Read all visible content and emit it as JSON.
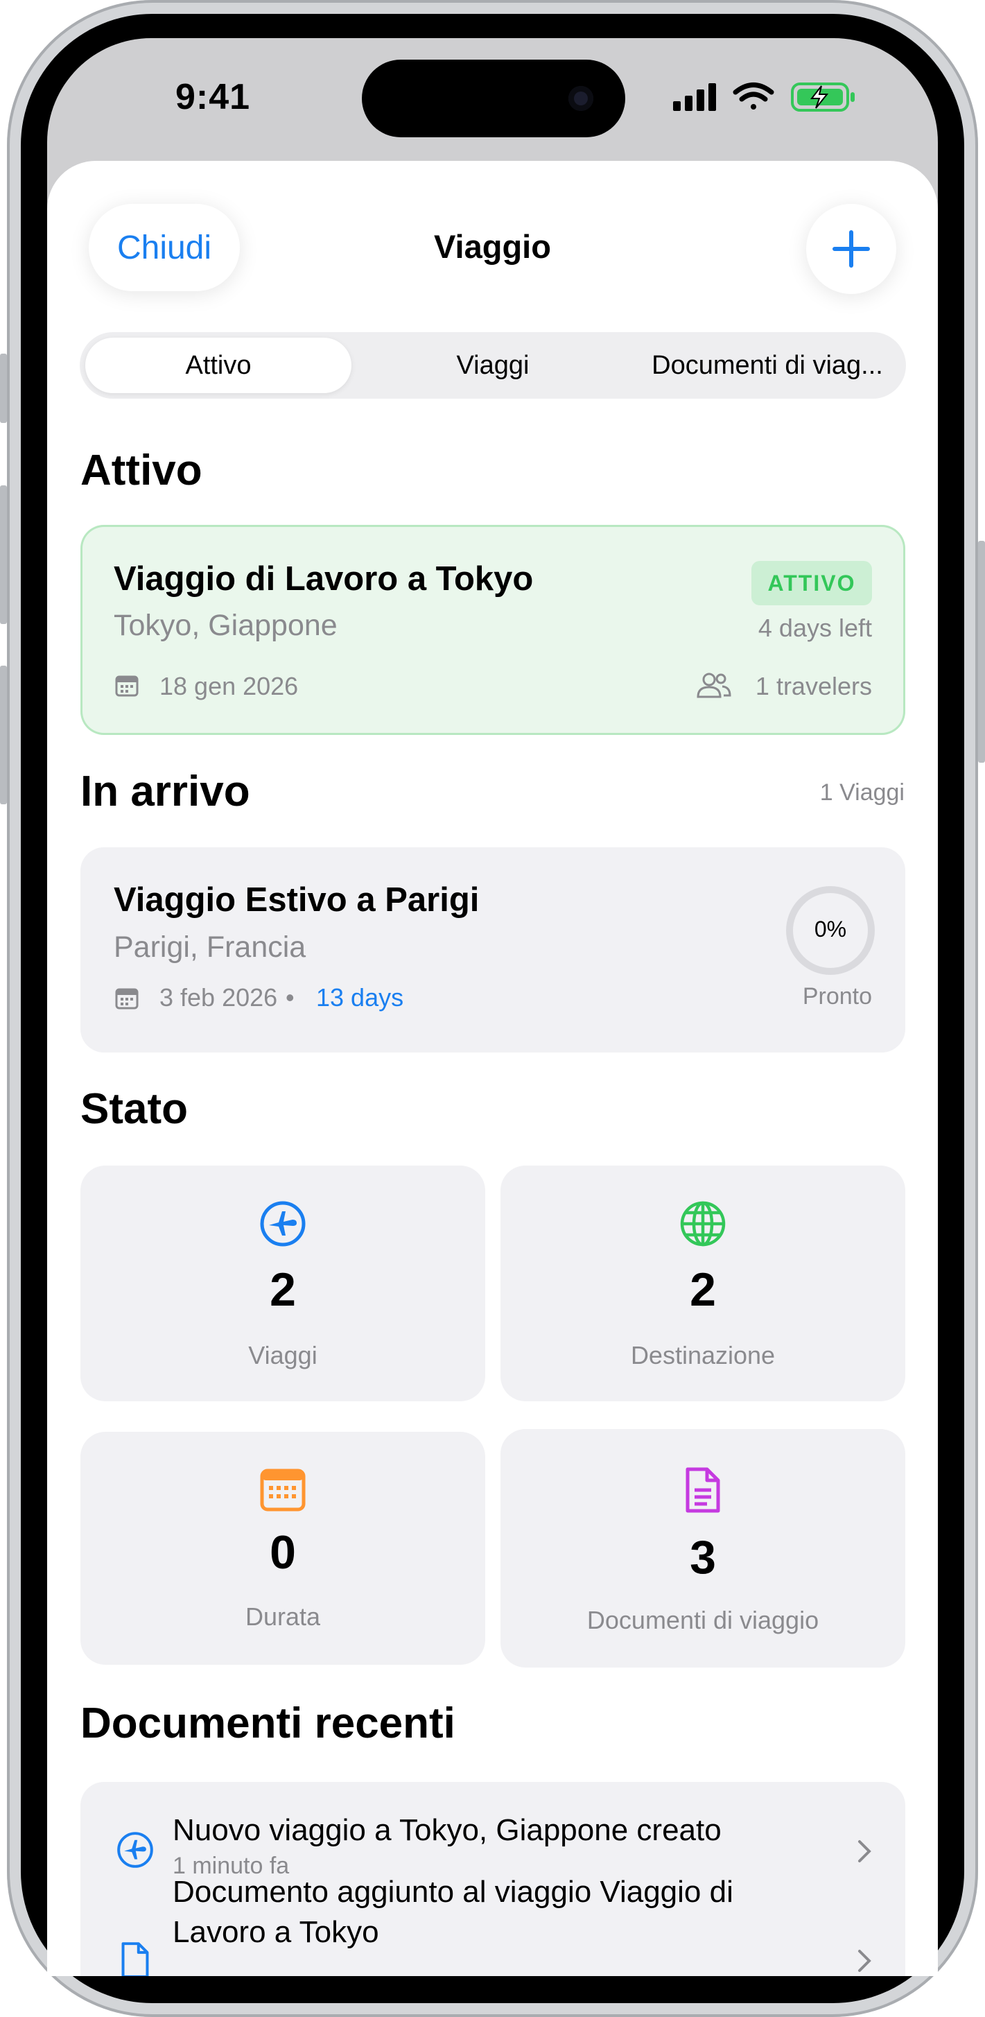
{
  "status_bar": {
    "time": "9:41"
  },
  "header": {
    "close_label": "Chiudi",
    "title": "Viaggio",
    "add_icon": "plus-icon"
  },
  "segments": [
    {
      "label": "Attivo",
      "selected": true
    },
    {
      "label": "Viaggi",
      "selected": false
    },
    {
      "label": "Documenti di viag...",
      "selected": false
    }
  ],
  "active_section": {
    "heading": "Attivo",
    "trip": {
      "title": "Viaggio di Lavoro a Tokyo",
      "location": "Tokyo, Giappone",
      "badge": "ATTIVO",
      "remaining": "4 days left",
      "date": "18 gen 2026",
      "travelers": "1 travelers"
    }
  },
  "upcoming_section": {
    "heading": "In arrivo",
    "count": "1 Viaggi",
    "trip": {
      "title": "Viaggio Estivo a Parigi",
      "location": "Parigi, Francia",
      "date": "3 feb 2026",
      "separator": "•",
      "countdown": "13 days",
      "progress_label": "0%",
      "progress_value": 0,
      "ready_label": "Pronto"
    }
  },
  "stats_section": {
    "heading": "Stato",
    "stats": [
      {
        "icon": "airplane-icon",
        "value": "2",
        "label": "Viaggi",
        "color": "#1a7ff0"
      },
      {
        "icon": "globe-icon",
        "value": "2",
        "label": "Destinazione",
        "color": "#33c759"
      },
      {
        "icon": "calendar-icon",
        "value": "0",
        "label": "Durata",
        "color": "#ff9530"
      },
      {
        "icon": "document-icon",
        "value": "3",
        "label": "Documenti di viaggio",
        "color": "#c53ae0"
      }
    ]
  },
  "recent_section": {
    "heading": "Documenti recenti",
    "items": [
      {
        "icon": "airplane-icon",
        "title": "Nuovo viaggio a Tokyo, Giappone creato",
        "subtitle": "1 minuto fa"
      },
      {
        "icon": "document-icon",
        "title_line1": "Documento aggiunto al viaggio Viaggio di",
        "title_line2": "Lavoro a Tokyo"
      }
    ]
  },
  "colors": {
    "accent": "#1a7ff0",
    "active_green": "#33c759",
    "secondary_text": "#8a8a8e"
  }
}
